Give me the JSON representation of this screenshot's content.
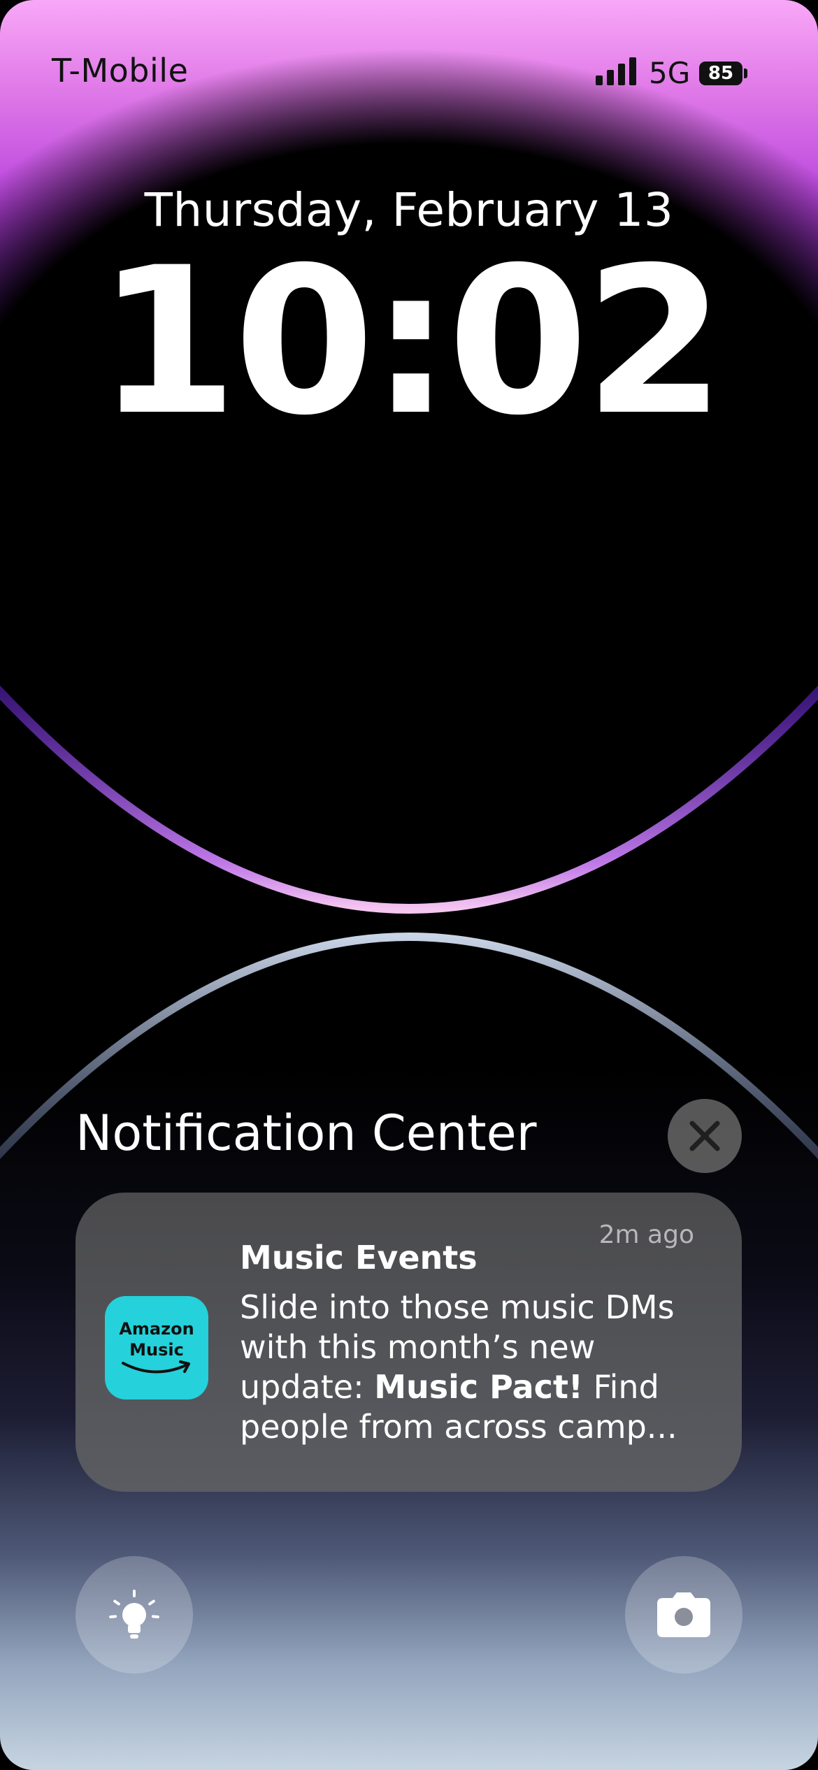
{
  "status_bar": {
    "carrier": "T-Mobile",
    "network": "5G",
    "battery": "85",
    "signal_icon": "cellular-signal-icon"
  },
  "lock_screen": {
    "date": "Thursday, February 13",
    "time": "10:02"
  },
  "notification_center": {
    "title": "Notification Center",
    "close_icon": "close-icon",
    "notifications": [
      {
        "app_icon_label": "Amazon\nMusic",
        "app_icon_color": "#25d1da",
        "time": "2m ago",
        "title": "Music Events",
        "body_pre": "Slide into those music DMs with this month’s new update: ",
        "body_bold": "Music Pact!",
        "body_post": " Find people from across camp..."
      }
    ]
  },
  "quick_actions": {
    "flashlight_icon": "flashlight-icon",
    "camera_icon": "camera-icon"
  }
}
